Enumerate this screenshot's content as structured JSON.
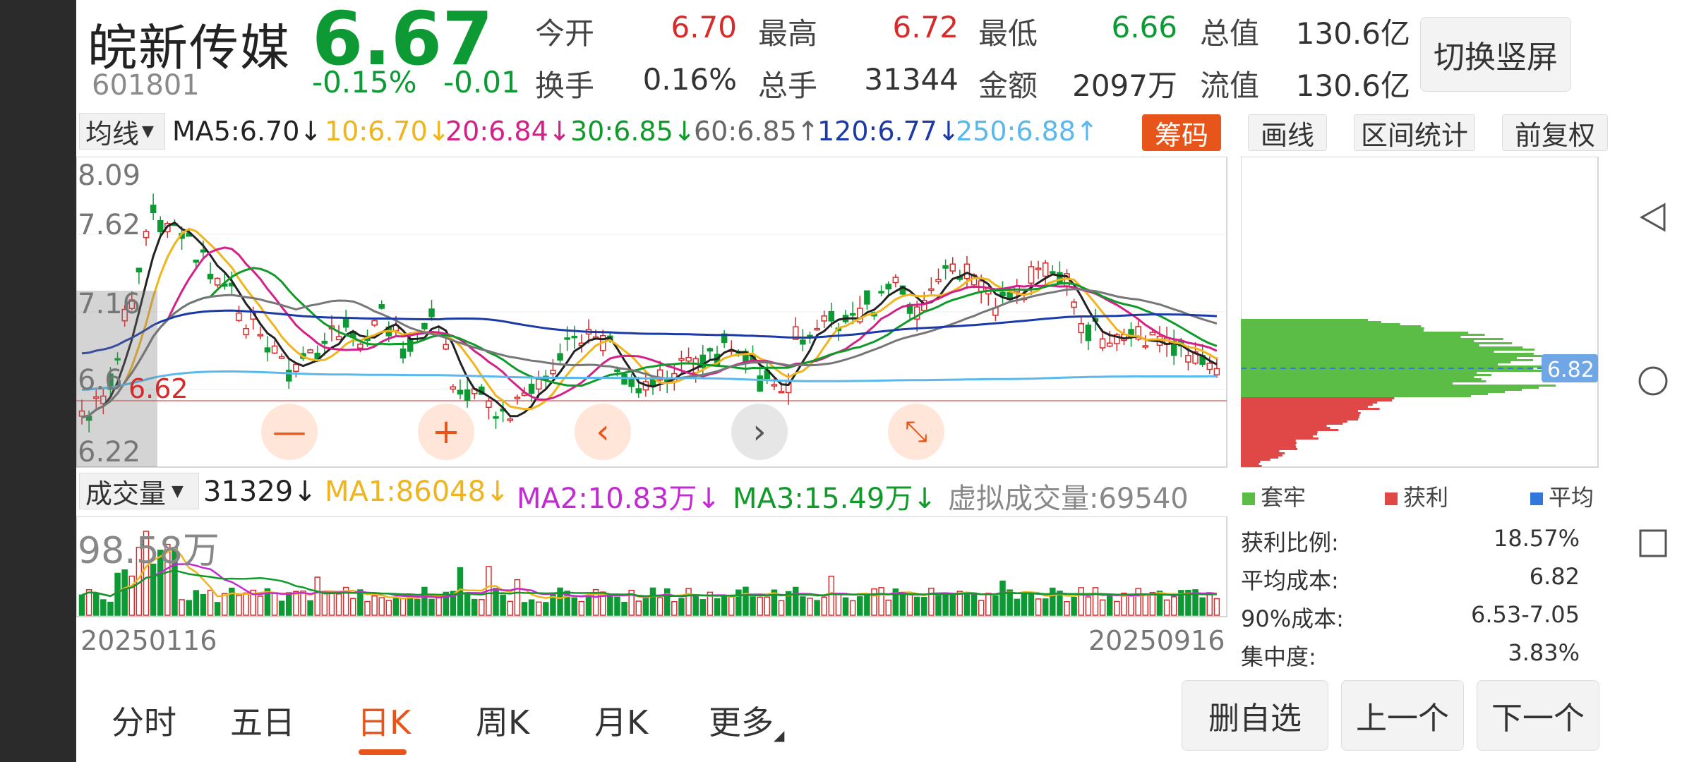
{
  "header": {
    "name": "皖新传媒",
    "code": "601801",
    "price": "6.67",
    "change_pct": "-0.15%",
    "change_abs": "-0.01",
    "stats": [
      {
        "label": "今开",
        "value": "6.70",
        "color": "red"
      },
      {
        "label": "最高",
        "value": "6.72",
        "color": "red"
      },
      {
        "label": "最低",
        "value": "6.66",
        "color": "green"
      },
      {
        "label": "总值",
        "value": "130.6亿",
        "color": "dark"
      },
      {
        "label": "换手",
        "value": "0.16%",
        "color": "dark"
      },
      {
        "label": "总手",
        "value": "31344",
        "color": "dark"
      },
      {
        "label": "金额",
        "value": "2097万",
        "color": "dark"
      },
      {
        "label": "流值",
        "value": "130.6亿",
        "color": "dark"
      }
    ],
    "switch_label": "切换竖屏"
  },
  "ma_bar": {
    "dropdown": "均线",
    "items": [
      {
        "text": "MA5:6.70↓",
        "color": "#222222"
      },
      {
        "text": "10:6.70↓",
        "color": "#f0b41c"
      },
      {
        "text": "20:6.84↓",
        "color": "#d4218a"
      },
      {
        "text": "30:6.85↓",
        "color": "#0f9a2a"
      },
      {
        "text": "60:6.85↑",
        "color": "#666666"
      },
      {
        "text": "120:6.77↓",
        "color": "#1b3aa8"
      },
      {
        "text": "250:6.88↑",
        "color": "#5bb8ec"
      }
    ]
  },
  "tools": {
    "chips": "筹码",
    "draw": "画线",
    "range_stats": "区间统计",
    "adjust": "前复权"
  },
  "price_axis": {
    "max": "8.09",
    "t2": "7.62",
    "t3": "7.16",
    "t4": "6.6",
    "min": "6.22",
    "ref_label": "6.62"
  },
  "volume_bar": {
    "dropdown": "成交量",
    "items": [
      {
        "text": "31329↓",
        "color": "#222222"
      },
      {
        "text": "MA1:86048↓",
        "color": "#f0b41c"
      },
      {
        "text": "MA2:10.83万↓",
        "color": "#c42ad4"
      },
      {
        "text": "MA3:15.49万↓",
        "color": "#0f9a2a"
      },
      {
        "text": "虚拟成交量:69540",
        "color": "#888888"
      }
    ],
    "max_label": "98.58万"
  },
  "dates": {
    "start": "20250116",
    "end": "20250916"
  },
  "chip_panel": {
    "avg_label": "6.82",
    "legend": [
      {
        "label": "套牢",
        "color": "#5bbd45"
      },
      {
        "label": "获利",
        "color": "#e04848"
      },
      {
        "label": "平均",
        "color": "#3377dd"
      }
    ],
    "rows": [
      {
        "label": "获利比例:",
        "value": "18.57%"
      },
      {
        "label": "平均成本:",
        "value": "6.82"
      },
      {
        "label": "90%成本:",
        "value": "6.53-7.05"
      },
      {
        "label": "集中度:",
        "value": "3.83%"
      }
    ]
  },
  "tabs": [
    {
      "label": "分时"
    },
    {
      "label": "五日"
    },
    {
      "label": "日K"
    },
    {
      "label": "周K"
    },
    {
      "label": "月K"
    },
    {
      "label": "更多"
    }
  ],
  "buttons": {
    "delete_watch": "删自选",
    "prev": "上一个",
    "next": "下一个"
  },
  "colors": {
    "up": "#d72a2a",
    "down": "#0d9a34",
    "accent": "#e8551a"
  }
}
